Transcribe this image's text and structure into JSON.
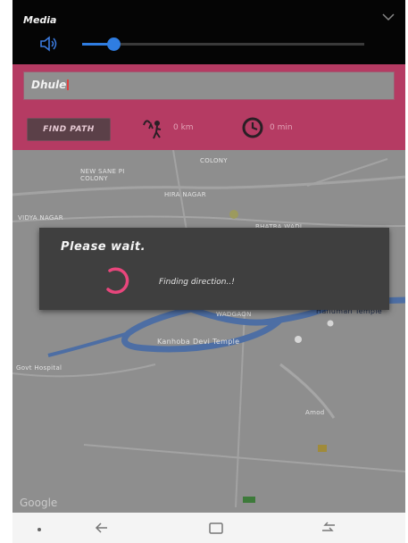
{
  "media": {
    "title": "Media",
    "volume_fraction": 0.11
  },
  "toolbar": {
    "search_value": "Dhule",
    "find_path_label": "FIND PATH",
    "distance_text": "0 km",
    "time_text": "0 min",
    "accent_color": "#b53b63"
  },
  "map": {
    "labels": [
      "COLONY",
      "NEW SANE PI COLONY",
      "HIRA NAGAR",
      "VIDYA NAGAR",
      "Bhatra Wadi",
      "WADGAON",
      "Kanhoba Devi Temple",
      "Hanuman Temple",
      "Amod",
      "Govt Hospital"
    ],
    "brand": "Google"
  },
  "dialog": {
    "title": "Please wait.",
    "message": "Finding direction..!"
  },
  "navbar": {
    "icons": [
      "dot-icon",
      "back-icon",
      "recents-icon",
      "switch-apps-icon"
    ]
  }
}
